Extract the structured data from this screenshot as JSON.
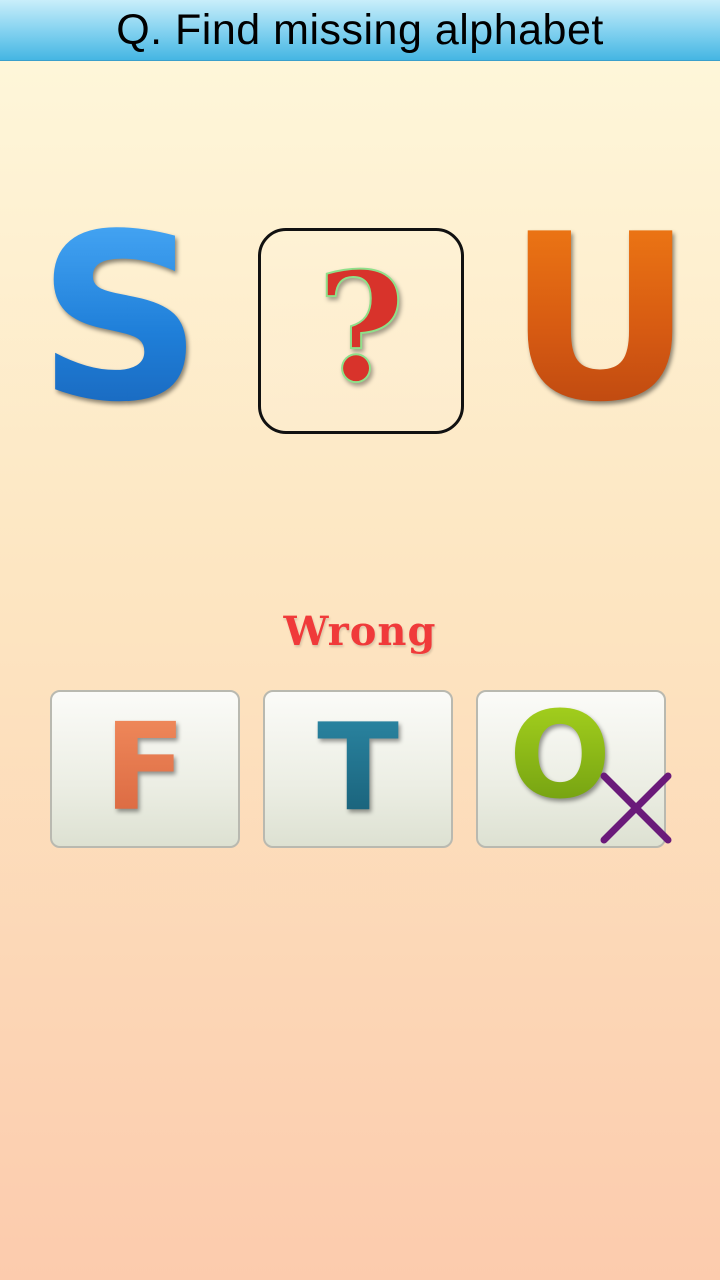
{
  "header": {
    "title": "Q. Find missing alphabet"
  },
  "puzzle": {
    "left_letter": "S",
    "missing_symbol": "?",
    "right_letter": "U",
    "colors": {
      "left_letter": "#1f7fd9",
      "missing_symbol": "#d8332b",
      "right_letter": "#d65a12"
    }
  },
  "feedback": {
    "text": "Wrong",
    "color": "#f03a3a"
  },
  "options": [
    {
      "letter": "F",
      "color": "#e3724a",
      "state": "default"
    },
    {
      "letter": "T",
      "color": "#1f6d86",
      "state": "default"
    },
    {
      "letter": "O",
      "color": "#8dbb1a",
      "state": "wrong",
      "mark_icon": "cross-icon",
      "mark_color": "#6a1a7a"
    }
  ]
}
